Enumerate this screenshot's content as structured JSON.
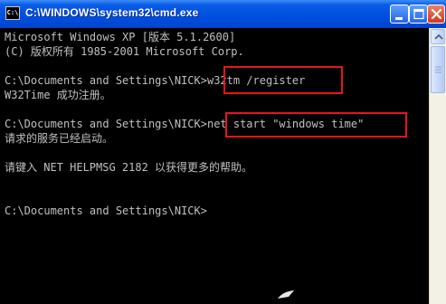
{
  "window": {
    "title": "C:\\WINDOWS\\system32\\cmd.exe",
    "icon_text": "C:\\"
  },
  "console": {
    "lines": [
      "Microsoft Windows XP [版本 5.1.2600]",
      "(C) 版权所有 1985-2001 Microsoft Corp.",
      "C:\\Documents and Settings\\NICK>w32tm /register",
      "W32Time 成功注册。",
      "C:\\Documents and Settings\\NICK>net start \"windows time\"",
      "请求的服务已经启动。",
      "请键入 NET HELPMSG 2182 以获得更多的帮助。",
      "C:\\Documents and Settings\\NICK>"
    ]
  },
  "colors": {
    "titlebar": "#0050e0",
    "console_bg": "#000000",
    "console_text": "#c0c0c0",
    "highlight": "#e8141e"
  }
}
